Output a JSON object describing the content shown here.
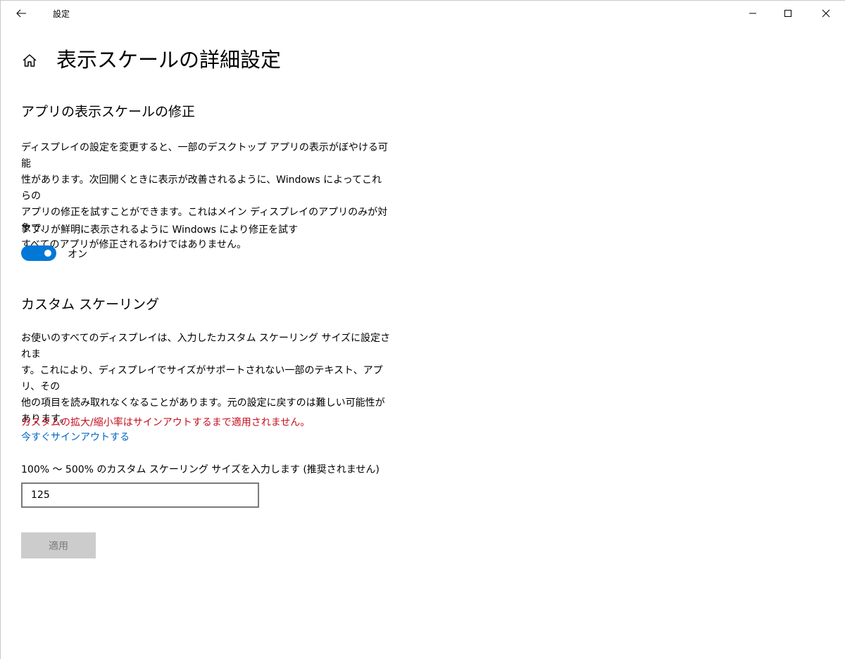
{
  "window": {
    "title": "設定",
    "icons": {
      "back": "back-arrow-icon",
      "minimize": "minimize-icon",
      "maximize": "maximize-icon",
      "close": "close-icon",
      "home": "home-icon"
    }
  },
  "header": {
    "title": "表示スケールの詳細設定"
  },
  "fix_scaling": {
    "heading": "アプリの表示スケールの修正",
    "description_lines": [
      "ディスプレイの設定を変更すると、一部のデスクトップ アプリの表示がぼやける可能",
      "性があります。次回開くときに表示が改善されるように、Windows によってこれらの",
      "アプリの修正を試すことができます。これはメイン ディスプレイのアプリのみが対象で、",
      "すべてのアプリが修正されるわけではありません。"
    ],
    "toggle_label": "アプリが鮮明に表示されるように Windows により修正を試す",
    "toggle_state": "オン",
    "toggle_on": true
  },
  "custom_scaling": {
    "heading": "カスタム スケーリング",
    "description_lines": [
      "お使いのすべてのディスプレイは、入力したカスタム スケーリング サイズに設定されま",
      "す。これにより、ディスプレイでサイズがサポートされない一部のテキスト、アプリ、その",
      "他の項目を読み取れなくなることがあります。元の設定に戻すのは難しい可能性が",
      "あります。"
    ],
    "warning": "カスタムの拡大/縮小率はサインアウトするまで適用されません。",
    "signout_link": "今すぐサインアウトする",
    "input_label": "100% ～ 500% のカスタム スケーリング サイズを入力します (推奨されません)",
    "input_value": "125",
    "apply_label": "適用"
  },
  "colors": {
    "accent": "#0078d7",
    "link": "#0067c0",
    "warning": "#c50f1f",
    "disabled_button_bg": "#cccccc",
    "disabled_button_text": "#7a7a7a"
  }
}
